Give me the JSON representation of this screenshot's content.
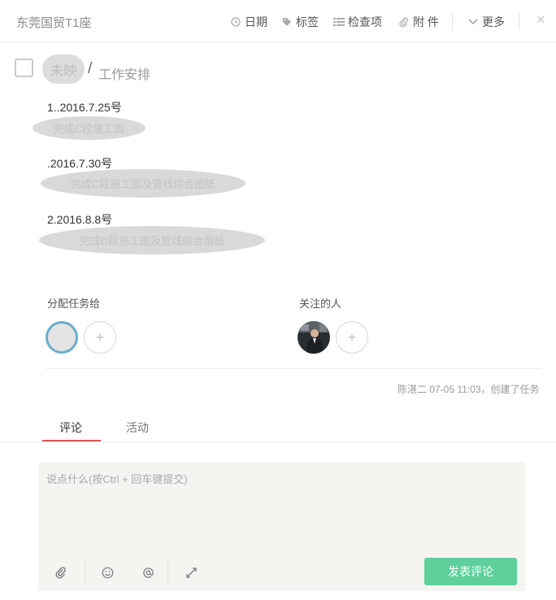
{
  "header": {
    "project": "东莞国贸T1座",
    "toolbar": [
      {
        "label": "日期",
        "icon": "clock-icon"
      },
      {
        "label": "标签",
        "icon": "tag-icon"
      },
      {
        "label": "检查项",
        "icon": "checklist-icon"
      },
      {
        "label": "附 件",
        "icon": "paperclip-icon"
      },
      {
        "label": "更多",
        "icon": "chevron-down-icon"
      }
    ],
    "close": "×"
  },
  "task": {
    "title_owner": "未映",
    "title_sep": "/",
    "title": "工作安排",
    "items": [
      {
        "date": "1..2016.7.25号",
        "detail": "完成C段施工图"
      },
      {
        "date": ".2016.7.30号",
        "detail": "完成C段施工图及管线综合图纸"
      },
      {
        "date": "2.2016.8.8号",
        "detail": "完成D段施工图及管线综合图纸"
      }
    ]
  },
  "members": {
    "assign_label": "分配任务给",
    "followers_label": "关注的人",
    "add": "+"
  },
  "activity_meta": "陈湛二 07-05 11:03，创建了任务",
  "tabs": {
    "comment": "评论",
    "activity": "活动"
  },
  "comment": {
    "placeholder": "说点什么(按Ctrl + 回车键提交)",
    "submit": "发表评论",
    "tools": [
      "paperclip-icon",
      "smiley-icon",
      "at-icon",
      "expand-icon"
    ]
  },
  "colors": {
    "accent_green": "#5fcf9c",
    "tab_underline": "#d9534f",
    "avatar_ring": "#6aaecc"
  }
}
